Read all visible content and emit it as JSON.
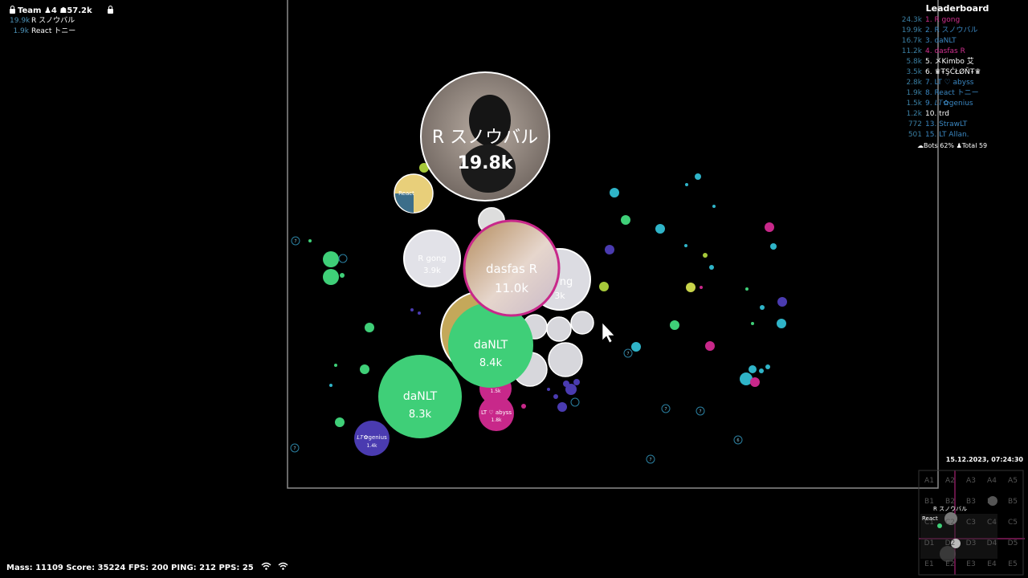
{
  "team": {
    "title": "Team",
    "players_count": "4",
    "total_mass": "57.2k",
    "members": [
      {
        "mass": "19.9k",
        "name": "R スノウバル"
      },
      {
        "mass": "1.9k",
        "name": "React トニー"
      }
    ]
  },
  "leaderboard": {
    "title": "Leaderboard",
    "entries": [
      {
        "mass": "24.3k",
        "rank_name": "1. R gong",
        "color": "#d0308f"
      },
      {
        "mass": "19.9k",
        "rank_name": "2. R スノウバル",
        "color": "#3a86c0"
      },
      {
        "mass": "16.7k",
        "rank_name": "3. daNLT",
        "color": "#3a86c0"
      },
      {
        "mass": "11.2k",
        "rank_name": "4. dasfas R",
        "color": "#d0308f"
      },
      {
        "mass": "5.8k",
        "rank_name": "5. メKimbo 艾",
        "color": "#ffffff"
      },
      {
        "mass": "3.5k",
        "rank_name": "6. ♛ŦŞĆŁØŇŦ♛",
        "color": "#ffffff"
      },
      {
        "mass": "2.8k",
        "rank_name": "7. LT ♡ abyss",
        "color": "#3a86c0"
      },
      {
        "mass": "1.9k",
        "rank_name": "8. React トニー",
        "color": "#3a86c0"
      },
      {
        "mass": "1.5k",
        "rank_name": "9. 𝐿𝑇✿genius",
        "color": "#3a86c0"
      },
      {
        "mass": "1.2k",
        "rank_name": "10. trd",
        "color": "#ffffff"
      },
      {
        "mass": "772",
        "rank_name": "13. StrawLT",
        "color": "#3a86c0"
      },
      {
        "mass": "501",
        "rank_name": "15. LT Allan.",
        "color": "#3a86c0"
      }
    ],
    "bots": "Bots 62%",
    "total": "Total 59"
  },
  "status_bar": {
    "text": "Mass: 11109  Score: 35224  FPS: 200  PING: 212  PPS: 25"
  },
  "clock": "15.12.2023, 07:24:30",
  "minimap": {
    "cells": [
      "A1",
      "A2",
      "A3",
      "A4",
      "A5",
      "B1",
      "B2",
      "B3",
      "B4",
      "B5",
      "C1",
      "C2",
      "C3",
      "C4",
      "C5",
      "D1",
      "D2",
      "D3",
      "D4",
      "D5",
      "E1",
      "E2",
      "E3",
      "E4",
      "E5"
    ],
    "labels": [
      "R スノウバル",
      "React"
    ]
  },
  "cells": {
    "snowball": {
      "name": "R スノウバル",
      "mass": "19.8k"
    },
    "dasfas": {
      "name": "dasfas R",
      "mass": "11.0k"
    },
    "danlt_a": {
      "name": "daNLT",
      "mass": "8.4k"
    },
    "danlt_b": {
      "name": "daNLT",
      "mass": "8.3k"
    },
    "rgong_small": {
      "name": "R gong",
      "mass": "3.9k"
    },
    "gong_partial": {
      "name": "ng",
      "mass": "3k"
    },
    "react_small": {
      "name": "React"
    },
    "abyss": {
      "name": "LT ♡ abyss",
      "mass": "1.8k"
    },
    "abyss_small": {
      "mass": "1.5k"
    },
    "genius": {
      "name": "𝐿𝑇✿genius",
      "mass": "1.4k"
    }
  },
  "virus_label": "7",
  "virus_label_b": "6",
  "colors": {
    "border": "#8a8a8a",
    "green": "#3fcf78",
    "magenta": "#c8288a",
    "purple": "#4a3bb0",
    "cyan": "#2fb4c8"
  }
}
